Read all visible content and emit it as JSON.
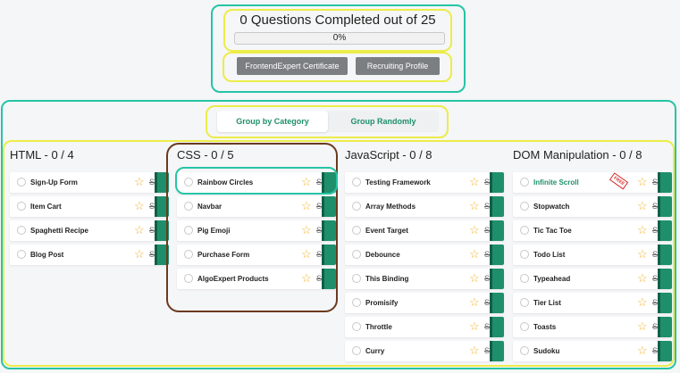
{
  "header": {
    "title": "0 Questions Completed out of 25",
    "progress_percent": 0,
    "progress_text": "0%",
    "cert_button": "FrontendExpert Certificate",
    "recruiting_button": "Recruiting Profile"
  },
  "grouping": {
    "by_category": "Group by Category",
    "randomly": "Group Randomly",
    "active": "by_category"
  },
  "colors": {
    "accent": "#1f8f6b",
    "star": "#f0b429",
    "new_badge": "#d62b2b"
  },
  "columns": [
    {
      "title": "HTML - 0 / 4",
      "questions": [
        {
          "name": "Sign-Up Form"
        },
        {
          "name": "Item Cart"
        },
        {
          "name": "Spaghetti Recipe"
        },
        {
          "name": "Blog Post"
        }
      ]
    },
    {
      "title": "CSS - 0 / 5",
      "questions": [
        {
          "name": "Rainbow Circles"
        },
        {
          "name": "Navbar"
        },
        {
          "name": "Pig Emoji"
        },
        {
          "name": "Purchase Form"
        },
        {
          "name": "AlgoExpert Products"
        }
      ]
    },
    {
      "title": "JavaScript - 0 / 8",
      "questions": [
        {
          "name": "Testing Framework"
        },
        {
          "name": "Array Methods"
        },
        {
          "name": "Event Target"
        },
        {
          "name": "Debounce"
        },
        {
          "name": "This Binding"
        },
        {
          "name": "Promisify"
        },
        {
          "name": "Throttle"
        },
        {
          "name": "Curry"
        }
      ]
    },
    {
      "title": "DOM Manipulation - 0 / 8",
      "questions": [
        {
          "name": "Infinite Scroll",
          "highlight": true,
          "badge": "FREE"
        },
        {
          "name": "Stopwatch"
        },
        {
          "name": "Tic Tac Toe"
        },
        {
          "name": "Todo List"
        },
        {
          "name": "Typeahead"
        },
        {
          "name": "Tier List"
        },
        {
          "name": "Toasts"
        },
        {
          "name": "Sudoku"
        }
      ]
    }
  ],
  "icons": {
    "star": "☆",
    "strike": "S"
  }
}
